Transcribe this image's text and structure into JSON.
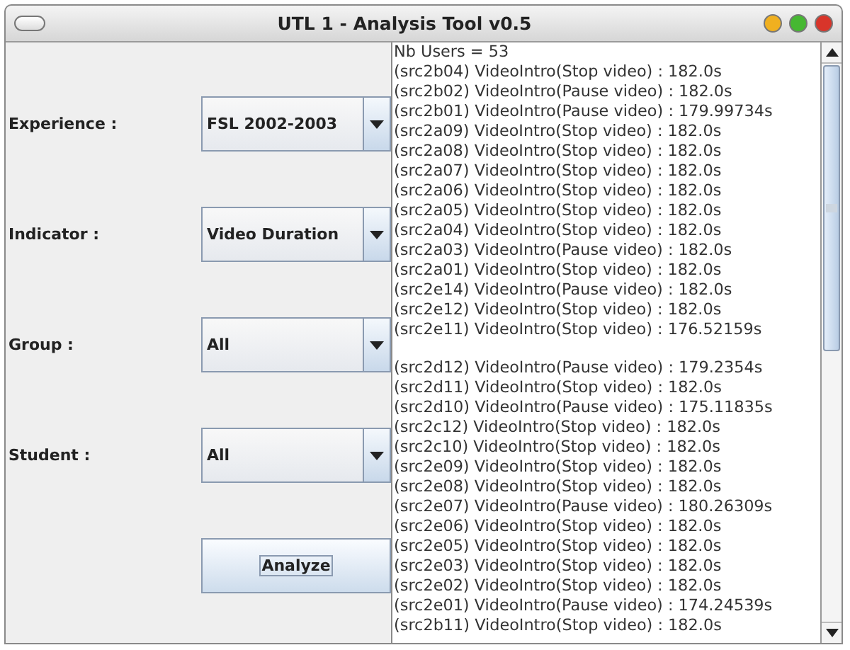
{
  "window": {
    "title": "UTL 1 - Analysis Tool v0.5"
  },
  "form": [
    {
      "label": "Experience :",
      "value": "FSL 2002-2003"
    },
    {
      "label": "Indicator :",
      "value": "Video Duration"
    },
    {
      "label": "Group :",
      "value": "All"
    },
    {
      "label": "Student :",
      "value": "All"
    }
  ],
  "analyze_button": {
    "label": "Analyze",
    "focused": true
  },
  "output": {
    "groups": [
      [
        "Nb Users = 53",
        "(src2b04) VideoIntro(Stop video) : 182.0s",
        "(src2b02) VideoIntro(Pause video) : 182.0s",
        "(src2b01) VideoIntro(Pause video) : 179.99734s",
        "(src2a09) VideoIntro(Stop video) : 182.0s",
        "(src2a08) VideoIntro(Stop video) : 182.0s",
        "(src2a07) VideoIntro(Stop video) : 182.0s",
        "(src2a06) VideoIntro(Stop video) : 182.0s",
        "(src2a05) VideoIntro(Stop video) : 182.0s",
        "(src2a04) VideoIntro(Stop video) : 182.0s",
        "(src2a03) VideoIntro(Pause video) : 182.0s",
        "(src2a01) VideoIntro(Stop video) : 182.0s",
        "(src2e14) VideoIntro(Pause video) : 182.0s",
        "(src2e12) VideoIntro(Stop video) : 182.0s",
        "(src2e11) VideoIntro(Stop video) : 176.52159s"
      ],
      [
        "(src2d12) VideoIntro(Pause video) : 179.2354s",
        "(src2d11) VideoIntro(Stop video) : 182.0s",
        "(src2d10) VideoIntro(Pause video) : 175.11835s",
        "(src2c12) VideoIntro(Stop video) : 182.0s",
        "(src2c10) VideoIntro(Stop video) : 182.0s",
        "(src2e09) VideoIntro(Stop video) : 182.0s",
        "(src2e08) VideoIntro(Stop video) : 182.0s",
        "(src2e07) VideoIntro(Pause video) : 180.26309s",
        "(src2e06) VideoIntro(Stop video) : 182.0s",
        "(src2e05) VideoIntro(Stop video) : 182.0s",
        "(src2e03) VideoIntro(Stop video) : 182.0s",
        "(src2e02) VideoIntro(Stop video) : 182.0s",
        "(src2e01) VideoIntro(Pause video) : 174.24539s",
        "(src2b11) VideoIntro(Stop video) : 182.0s"
      ]
    ]
  }
}
